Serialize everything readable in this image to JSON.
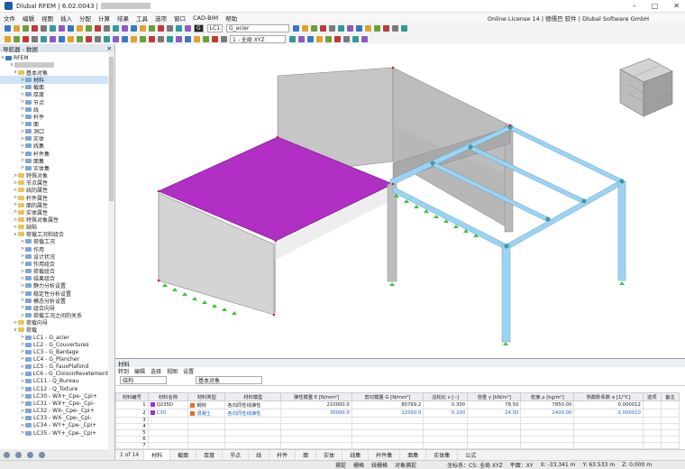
{
  "app": {
    "title": "Dlubal RFEM | 6.02.0043 |"
  },
  "menu": [
    "文件",
    "编辑",
    "视图",
    "插入",
    "分配",
    "计算",
    "结果",
    "工具",
    "选项",
    "窗口",
    "CAD-BIM",
    "帮助"
  ],
  "license": "Online License 14 | 德儒巴 软件 | Dlubal Software GmbH",
  "toolbar": {
    "lc_code": "G",
    "lc_id": "LC1",
    "lc_name": "G_acier",
    "coord": "1 - 全局 XYZ"
  },
  "navigator": {
    "title": "导航器 - 数据",
    "root": "RFEM",
    "items": [
      {
        "l": "基本对象",
        "d": 1,
        "o": "v"
      },
      {
        "l": "材料",
        "d": 2,
        "sel": true
      },
      {
        "l": "截面",
        "d": 2
      },
      {
        "l": "厚度",
        "d": 2
      },
      {
        "l": "节点",
        "d": 2
      },
      {
        "l": "线",
        "d": 2
      },
      {
        "l": "杆件",
        "d": 2
      },
      {
        "l": "面",
        "d": 2
      },
      {
        "l": "洞口",
        "d": 2
      },
      {
        "l": "实体",
        "d": 2
      },
      {
        "l": "线集",
        "d": 2
      },
      {
        "l": "杆件集",
        "d": 2
      },
      {
        "l": "面集",
        "d": 2
      },
      {
        "l": "实体集",
        "d": 2
      },
      {
        "l": "特殊对象",
        "d": 1
      },
      {
        "l": "节点属性",
        "d": 1
      },
      {
        "l": "线的属性",
        "d": 1
      },
      {
        "l": "杆件属性",
        "d": 1
      },
      {
        "l": "面的属性",
        "d": 1
      },
      {
        "l": "实体属性",
        "d": 1
      },
      {
        "l": "特殊对象属性",
        "d": 1
      },
      {
        "l": "缺陷",
        "d": 1
      },
      {
        "l": "荷载工况和组合",
        "d": 1,
        "o": "v"
      },
      {
        "l": "荷载工况",
        "d": 2
      },
      {
        "l": "作用",
        "d": 2
      },
      {
        "l": "设计状况",
        "d": 2
      },
      {
        "l": "作用组合",
        "d": 2
      },
      {
        "l": "荷载组合",
        "d": 2
      },
      {
        "l": "结果组合",
        "d": 2
      },
      {
        "l": "静力分析设置",
        "d": 2
      },
      {
        "l": "稳定性分析设置",
        "d": 2
      },
      {
        "l": "模态分析设置",
        "d": 2
      },
      {
        "l": "组合向导",
        "d": 2
      },
      {
        "l": "荷载工况之间的关系",
        "d": 2
      },
      {
        "l": "荷载向导",
        "d": 1
      },
      {
        "l": "荷载",
        "d": 1,
        "o": "v"
      },
      {
        "l": "LC1 - G_acier",
        "d": 2
      },
      {
        "l": "LC2 - G_Couvertures",
        "d": 2
      },
      {
        "l": "LC3 - G_Bardage",
        "d": 2
      },
      {
        "l": "LC4 - G_Plancher",
        "d": 2
      },
      {
        "l": "LC5 - G_FauxPlafond",
        "d": 2
      },
      {
        "l": "LC6 - G_CloisonRevetement",
        "d": 2
      },
      {
        "l": "LC11 - Q_Bureau",
        "d": 2
      },
      {
        "l": "LC12 - Q_Toiture",
        "d": 2
      },
      {
        "l": "LC30 - WX+_Cpe-_Cpi+",
        "d": 2
      },
      {
        "l": "LC31 - WX+_Cpe-_Cpi-",
        "d": 2
      },
      {
        "l": "LC32 - WX-_Cpe-_Cpi+",
        "d": 2
      },
      {
        "l": "LC33 - WX-_Cpe-_Cpi-",
        "d": 2
      },
      {
        "l": "LC34 - WY+_Cpe-_Cpi+",
        "d": 2
      },
      {
        "l": "LC35 - WY+_Cpe-_Cpi+",
        "d": 2
      }
    ]
  },
  "materials": {
    "title": "材料",
    "menu": [
      "转到",
      "编辑",
      "选择",
      "视图",
      "设置"
    ],
    "filter1": "结构",
    "filter2": "基本对象",
    "headers": [
      "材料编号",
      "材料名称",
      "材料类型",
      "材料模型",
      "弹性模量 E [N/mm²]",
      "剪切模量 G [N/mm²]",
      "泊松比 ν [--]",
      "容重 γ [kN/m³]",
      "密度 ρ [kg/m³]",
      "热膨胀系数 α [1/°C]",
      "选项",
      "备注"
    ],
    "rows": [
      {
        "no": "1",
        "name": "Q235D",
        "type": "钢材",
        "model": "各向同性线弹性",
        "E": "210000.0",
        "G": "80769.2",
        "nu": "0.300",
        "gamma": "78.50",
        "rho": "7850.00",
        "alpha": "0.000012",
        "color": "#9b30d9",
        "tcolor": "#d9742c"
      },
      {
        "no": "2",
        "name": "C30",
        "type": "混凝土",
        "model": "各向同性线弹性",
        "E": "30000.0",
        "G": "12500.0",
        "nu": "0.200",
        "gamma": "24.00",
        "rho": "2400.00",
        "alpha": "0.000010",
        "color": "#9b30d9",
        "tcolor": "#d9742c"
      }
    ]
  },
  "pager": {
    "page": "1 of 14",
    "tabs": [
      "材料",
      "截面",
      "厚度",
      "节点",
      "线",
      "杆件",
      "面",
      "实体",
      "线集",
      "杆件集",
      "面集",
      "实体集",
      "公式"
    ]
  },
  "status": {
    "snaps": [
      "捕捉",
      "栅格",
      "线栅格",
      "对象捕捉"
    ],
    "cs": "坐标系：CS: 全局 XYZ",
    "plane": "平面：XY",
    "x": "X: -33.341 m",
    "y": "Y: 63.533 m",
    "z": "Z: 0.000 m"
  }
}
